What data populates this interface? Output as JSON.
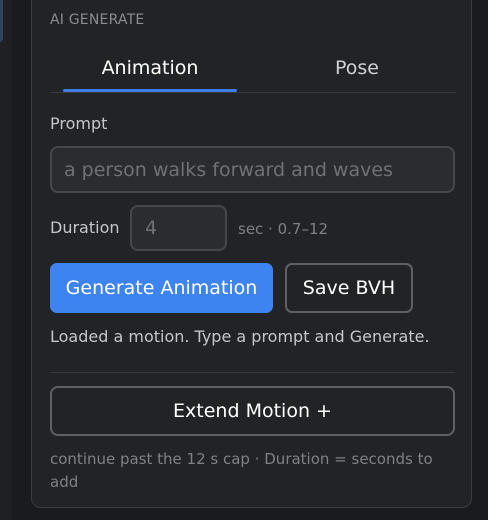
{
  "section": {
    "title": "AI GENERATE"
  },
  "tabs": [
    {
      "label": "Animation",
      "active": true
    },
    {
      "label": "Pose",
      "active": false
    }
  ],
  "prompt": {
    "label": "Prompt",
    "value": "",
    "placeholder": "a person walks forward and waves"
  },
  "duration": {
    "label": "Duration",
    "value": "",
    "placeholder": "4",
    "hint": "sec · 0.7–12"
  },
  "buttons": {
    "generate_label": "Generate Animation",
    "save_label": "Save BVH",
    "extend_label": "Extend Motion +"
  },
  "status": "Loaded a motion. Type a prompt and Generate.",
  "extend_hint": "continue past the 12 s cap · Duration = seconds to add",
  "colors": {
    "accent": "#3d84f0",
    "panel_bg": "#222326",
    "page_bg": "#1a1b1e"
  }
}
